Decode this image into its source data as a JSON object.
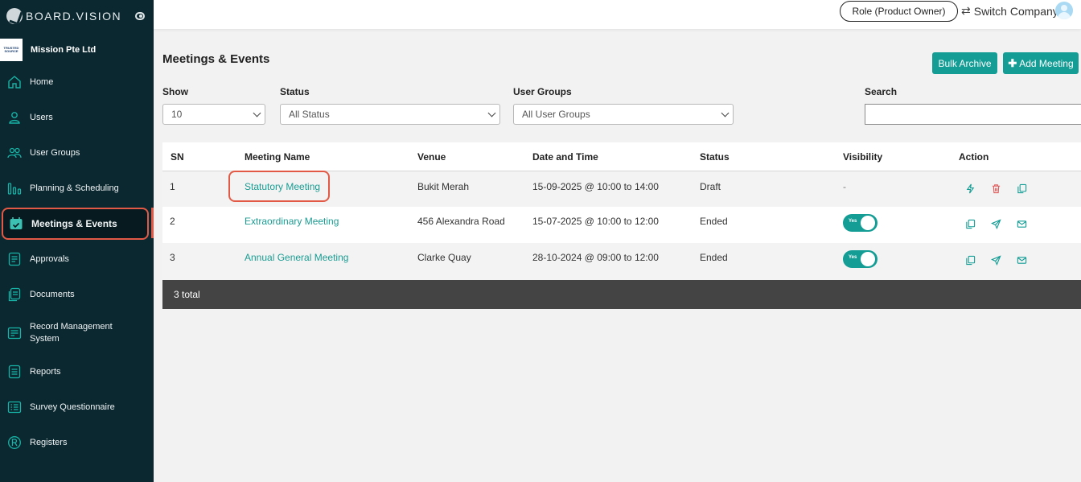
{
  "app": {
    "brand": "BOARD.VISION",
    "company_name": "Mission Pte Ltd",
    "company_logo_text": "TRUSTED SOURCE"
  },
  "sidebar": {
    "items": [
      {
        "label": "Home",
        "icon": "home-icon"
      },
      {
        "label": "Users",
        "icon": "user-icon"
      },
      {
        "label": "User Groups",
        "icon": "user-groups-icon"
      },
      {
        "label": "Planning & Scheduling",
        "icon": "bar-chart-icon"
      },
      {
        "label": "Meetings & Events",
        "icon": "calendar-check-icon",
        "active": true
      },
      {
        "label": "Approvals",
        "icon": "approvals-doc-icon"
      },
      {
        "label": "Documents",
        "icon": "documents-icon"
      },
      {
        "label": "Record Management System",
        "icon": "record-management-icon"
      },
      {
        "label": "Reports",
        "icon": "reports-icon"
      },
      {
        "label": "Survey Questionnaire",
        "icon": "survey-icon"
      },
      {
        "label": "Registers",
        "icon": "registered-icon"
      }
    ]
  },
  "topbar": {
    "role": "Role (Product Owner)",
    "switch_company": "Switch Company"
  },
  "page": {
    "title": "Meetings & Events",
    "bulk_archive": "Bulk Archive",
    "add_meeting": "Add Meeting"
  },
  "filters": {
    "show_label": "Show",
    "show_value": "10",
    "status_label": "Status",
    "status_value": "All Status",
    "groups_label": "User Groups",
    "groups_value": "All User Groups",
    "search_label": "Search",
    "search_value": ""
  },
  "table": {
    "headers": {
      "sn": "SN",
      "name": "Meeting Name",
      "venue": "Venue",
      "datetime": "Date and Time",
      "status": "Status",
      "visibility": "Visibility",
      "action": "Action"
    },
    "rows": [
      {
        "sn": "1",
        "name": "Statutory Meeting",
        "venue": "Bukit Merah",
        "datetime": "15-09-2025 @ 10:00 to 14:00",
        "status": "Draft",
        "visibility": "-",
        "toggle_label": ""
      },
      {
        "sn": "2",
        "name": "Extraordinary Meeting",
        "venue": "456 Alexandra Road",
        "datetime": "15-07-2025 @ 10:00 to 12:00",
        "status": "Ended",
        "visibility": "on",
        "toggle_label": "Yes"
      },
      {
        "sn": "3",
        "name": "Annual General Meeting",
        "venue": "Clarke Quay",
        "datetime": "28-10-2024 @ 09:00 to 12:00",
        "status": "Ended",
        "visibility": "on",
        "toggle_label": "Yes"
      }
    ],
    "footer": "3 total"
  },
  "colors": {
    "sidebar_bg": "#0b2830",
    "accent": "#139d95",
    "highlight": "#e25a45",
    "delete": "#e05a5a"
  }
}
